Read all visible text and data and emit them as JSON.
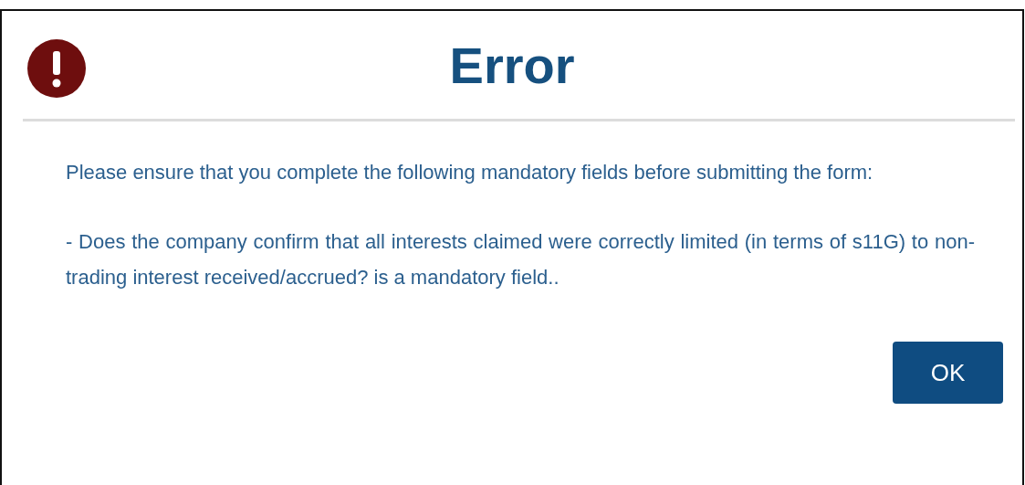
{
  "dialog": {
    "title": "Error",
    "paragraphs": [
      "Please ensure that you complete the following mandatory fields before submitting the form:",
      "- Does the company confirm that all interests claimed were correctly limited (in terms of s11G) to non-trading interest received/accrued? is a mandatory field.."
    ],
    "buttons": [
      "OK"
    ]
  }
}
